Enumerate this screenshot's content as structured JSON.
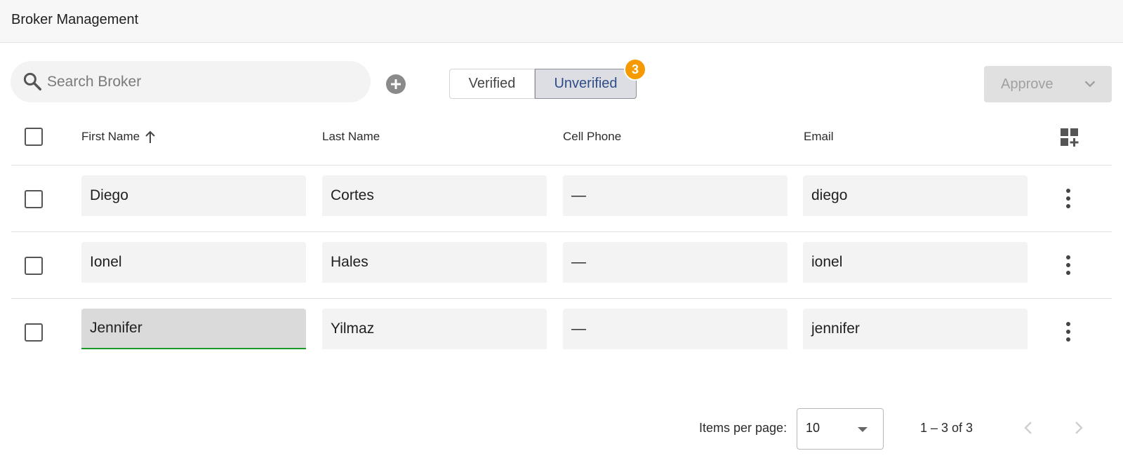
{
  "header": {
    "title": "Broker Management"
  },
  "search": {
    "placeholder": "Search Broker",
    "value": ""
  },
  "toggle": {
    "verified_label": "Verified",
    "unverified_label": "Unverified",
    "selected": "Unverified",
    "badge_count": "3"
  },
  "approve": {
    "label": "Approve"
  },
  "table": {
    "columns": [
      {
        "label": "First Name",
        "sort": "ascending"
      },
      {
        "label": "Last Name"
      },
      {
        "label": "Cell Phone"
      },
      {
        "label": "Email"
      }
    ],
    "rows": [
      {
        "first_name": "Diego",
        "last_name": "Cortes",
        "cell_phone": "—",
        "email": "diego"
      },
      {
        "first_name": "Ionel",
        "last_name": "Hales",
        "cell_phone": "—",
        "email": "ionel"
      },
      {
        "first_name": "Jennifer",
        "last_name": "Yilmaz",
        "cell_phone": "—",
        "email": "jennifer"
      }
    ]
  },
  "pagination": {
    "items_per_page_label": "Items per page:",
    "items_per_page": "10",
    "range_label": "1 – 3 of 3"
  },
  "colors": {
    "accent": "#2f4d86",
    "badge": "#f59a00",
    "active_underline": "#1c9a2a"
  }
}
